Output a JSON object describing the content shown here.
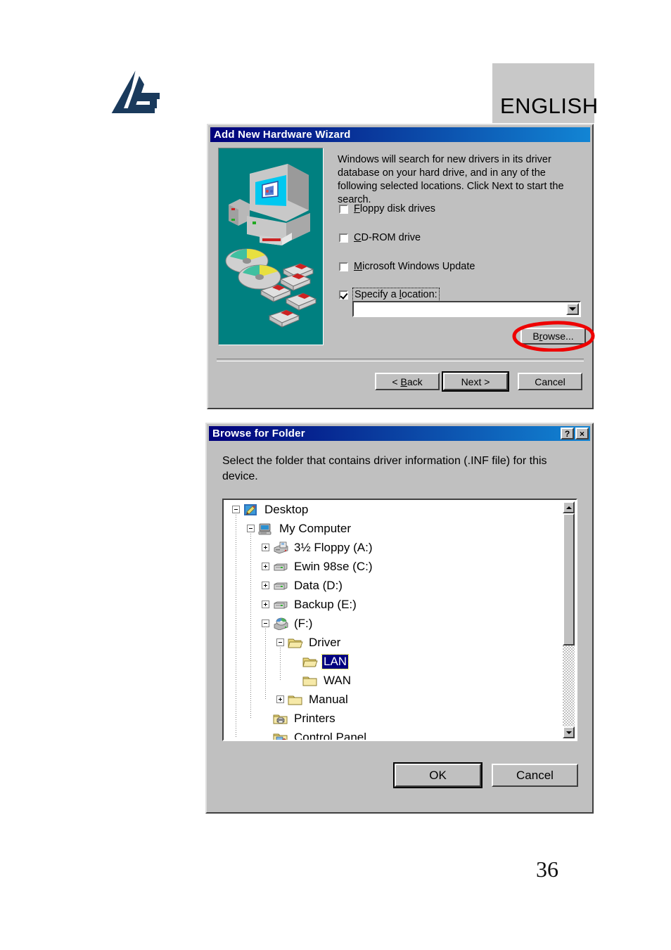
{
  "page": {
    "language_label": "ENGLISH",
    "page_number": "36",
    "logo_name": "atlantis-land-logo"
  },
  "wizard": {
    "title": "Add New Hardware Wizard",
    "body_text": "Windows will search for new drivers in its driver database on your hard drive, and in any of the following selected locations. Click Next to start the search.",
    "checkboxes": [
      {
        "label": "Floppy disk drives",
        "accel": "F",
        "checked": false
      },
      {
        "label": "CD-ROM drive",
        "accel": "C",
        "checked": false
      },
      {
        "label": "Microsoft Windows Update",
        "accel": "M",
        "checked": false
      },
      {
        "label": "Specify a location:",
        "accel": "l",
        "checked": true,
        "focused": true
      }
    ],
    "location_value": "",
    "browse_label": "Browse...",
    "browse_accel": "r",
    "buttons": {
      "back": "< Back",
      "back_accel": "B",
      "next": "Next >",
      "cancel": "Cancel",
      "default": "Next >"
    },
    "illustration": "computer-cds-disks-illustration",
    "illustration_bg": "#008080",
    "annotation": {
      "shape": "ellipse",
      "color": "#ee0000",
      "target": "Browse..."
    }
  },
  "browse_dialog": {
    "title": "Browse for Folder",
    "title_buttons": [
      {
        "name": "help-button",
        "glyph": "?"
      },
      {
        "name": "close-button",
        "glyph": "×"
      }
    ],
    "prompt": "Select the folder that contains driver information (.INF file) for this device.",
    "tree": [
      {
        "label": "Desktop",
        "depth": 0,
        "toggle": "minus",
        "icon": "desktop-icon",
        "selected": false
      },
      {
        "label": "My Computer",
        "depth": 1,
        "toggle": "minus",
        "icon": "computer-icon",
        "selected": false
      },
      {
        "label": "3½ Floppy (A:)",
        "depth": 2,
        "toggle": "plus",
        "icon": "floppy-drive-icon",
        "selected": false
      },
      {
        "label": "Ewin 98se (C:)",
        "depth": 2,
        "toggle": "plus",
        "icon": "hard-drive-icon",
        "selected": false
      },
      {
        "label": "Data (D:)",
        "depth": 2,
        "toggle": "plus",
        "icon": "hard-drive-icon",
        "selected": false
      },
      {
        "label": "Backup (E:)",
        "depth": 2,
        "toggle": "plus",
        "icon": "hard-drive-icon",
        "selected": false
      },
      {
        "label": "(F:)",
        "depth": 2,
        "toggle": "minus",
        "icon": "cd-drive-icon",
        "selected": false
      },
      {
        "label": "Driver",
        "depth": 3,
        "toggle": "minus",
        "icon": "folder-open-icon",
        "selected": false
      },
      {
        "label": "LAN",
        "depth": 4,
        "toggle": "none",
        "icon": "folder-open-icon",
        "selected": true
      },
      {
        "label": "WAN",
        "depth": 4,
        "toggle": "none",
        "icon": "folder-icon",
        "selected": false
      },
      {
        "label": "Manual",
        "depth": 3,
        "toggle": "plus",
        "icon": "folder-icon",
        "selected": false
      },
      {
        "label": "Printers",
        "depth": 2,
        "toggle": "none",
        "icon": "printers-folder-icon",
        "selected": false
      },
      {
        "label": "Control Panel",
        "depth": 2,
        "toggle": "none",
        "icon": "control-panel-icon",
        "selected": false
      }
    ],
    "scrollbar": {
      "thumb_position": "top",
      "thumb_fraction": 62
    },
    "buttons": {
      "ok": "OK",
      "cancel": "Cancel",
      "default": "OK"
    }
  },
  "colors": {
    "dialog_face": "#c0c0c0",
    "titlebar_start": "#00007b",
    "titlebar_end": "#1285d4",
    "selection": "#000080",
    "wizard_art_bg": "#008080",
    "annotation_red": "#ee0000",
    "english_box_bg": "#c8c8c8",
    "logo_navy": "#1a3a5c"
  }
}
